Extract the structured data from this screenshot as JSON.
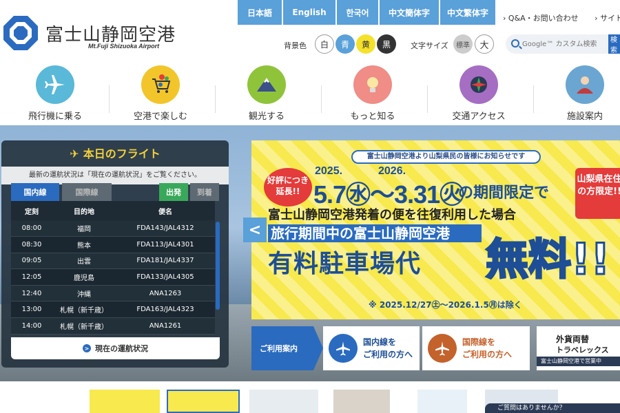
{
  "header": {
    "logo_text": "富士山静岡空港",
    "logo_sub": "Mt.Fuji Shizuoka Airport"
  },
  "languages": [
    "日本語",
    "English",
    "한국어",
    "中文簡体字",
    "中文繁体字"
  ],
  "util_links": [
    "Q&A・お問い合わせ",
    "サイトマップ"
  ],
  "background": {
    "label": "背景色",
    "options": [
      "白",
      "青",
      "黄",
      "黒"
    ]
  },
  "font_size": {
    "label": "文字サイズ",
    "options": [
      "標準",
      "大"
    ]
  },
  "search": {
    "placeholder": "Google™ カスタム検索",
    "button": "検索"
  },
  "nav": [
    {
      "label": "飛行機に乗る",
      "icon": "airplane-icon"
    },
    {
      "label": "空港で楽しむ",
      "icon": "shopping-icon"
    },
    {
      "label": "観光する",
      "icon": "mountain-icon"
    },
    {
      "label": "もっと知る",
      "icon": "lightbulb-icon"
    },
    {
      "label": "交通アクセス",
      "icon": "compass-icon"
    },
    {
      "label": "施設案内",
      "icon": "staff-icon"
    }
  ],
  "flight": {
    "title": "本日のフライト",
    "note": "最新の運航状況は「現在の運航状況」をご覧ください。",
    "tabs": {
      "domestic": "国内線",
      "international": "国際線",
      "departure": "出発",
      "arrival": "到着"
    },
    "columns": [
      "定刻",
      "目的地",
      "便名"
    ],
    "rows": [
      {
        "time": "08:00",
        "dest": "福岡",
        "flight": "FDA143/JAL4312"
      },
      {
        "time": "08:30",
        "dest": "熊本",
        "flight": "FDA113/JAL4301"
      },
      {
        "time": "09:05",
        "dest": "出雲",
        "flight": "FDA181/JAL4337"
      },
      {
        "time": "12:05",
        "dest": "鹿児島",
        "flight": "FDA133/JAL4305"
      },
      {
        "time": "12:40",
        "dest": "沖縄",
        "flight": "ANA1263"
      },
      {
        "time": "13:00",
        "dest": "札幌（新千歳）",
        "flight": "FDA163/JAL4323"
      },
      {
        "time": "14:00",
        "dest": "札幌（新千歳）",
        "flight": "ANA1261"
      }
    ],
    "status_button": "現在の運航状況"
  },
  "banner": {
    "notice": "富士山静岡空港より山梨県民の皆様にお知らせです",
    "badge": "好評につき延長!!",
    "year_start": "2025.",
    "year_end": "2026.",
    "date_range": "5.7㊌～3.31㊋",
    "limited": "の期間限定で",
    "pref_badge": "山梨県在住の方限定!!",
    "line2": "富士山静岡空港発着の便を往復利用した場合",
    "line3": "旅行期間中の富士山静岡空港",
    "line4": "有料駐車場代",
    "free": "無料!!",
    "exclusion": "※ 2025.12/27㊏～2026.1.5㊊は除く",
    "prev": "<"
  },
  "services": {
    "label": "ご利用案内",
    "domestic": [
      "国内線を",
      "ご利用の方へ"
    ],
    "international": [
      "国際線を",
      "ご利用の方へ"
    ],
    "fx_title": "外貨両替",
    "fx_sub": "トラベレックス",
    "fx_bar": "富士山静岡空港で営業中"
  },
  "bottom": {
    "chat": "ご質問はありませんか？"
  },
  "colors": {
    "accent": "#2a6bbf",
    "lang_bg": "#5aa0d9",
    "panel": "#263440",
    "banner_yellow": "#f7e94e"
  }
}
